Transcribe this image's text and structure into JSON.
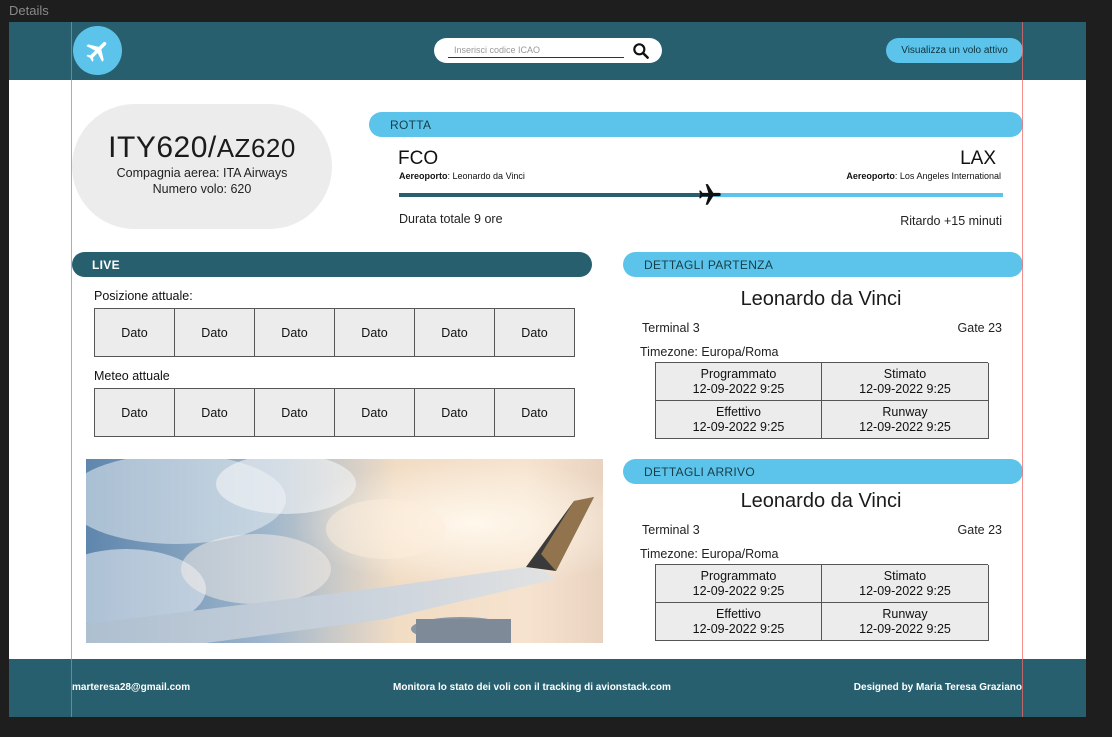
{
  "frame_label": "Details",
  "header": {
    "search_placeholder": "Inserisci codice ICAO",
    "active_flight_button": "Visualizza un volo attivo"
  },
  "flight": {
    "code_main": "ITY620/",
    "code_alt": "AZ620",
    "airline": "Compagnia aerea: ITA Airways",
    "number": "Numero volo: 620"
  },
  "route": {
    "title": "ROTTA",
    "origin_code": "FCO",
    "origin_airport_label": "Aereoporto",
    "origin_airport": ": Leonardo da Vinci",
    "destination_code": "LAX",
    "destination_airport_label": "Aereoporto",
    "destination_airport": ": Los Angeles International",
    "progress": 0.5,
    "duration": "Durata totale 9 ore",
    "delay": "Ritardo +15 minuti"
  },
  "live": {
    "title": "LIVE",
    "position_label": "Posizione attuale:",
    "position_cells": [
      "Dato",
      "Dato",
      "Dato",
      "Dato",
      "Dato",
      "Dato"
    ],
    "weather_label": "Meteo attuale",
    "weather_cells": [
      "Dato",
      "Dato",
      "Dato",
      "Dato",
      "Dato",
      "Dato"
    ]
  },
  "departure": {
    "title": "DETTAGLI PARTENZA",
    "airport": "Leonardo da Vinci",
    "terminal": "Terminal 3",
    "gate": "Gate 23",
    "timezone": "Timezone: Europa/Roma",
    "scheduled_label": "Programmato",
    "scheduled": "12-09-2022 9:25",
    "estimated_label": "Stimato",
    "estimated": "12-09-2022 9:25",
    "actual_label": "Effettivo",
    "actual": "12-09-2022 9:25",
    "runway_label": "Runway",
    "runway": "12-09-2022 9:25"
  },
  "arrival": {
    "title": "DETTAGLI ARRIVO",
    "airport": "Leonardo da Vinci",
    "terminal": "Terminal 3",
    "gate": "Gate 23",
    "timezone": "Timezone: Europa/Roma",
    "scheduled_label": "Programmato",
    "scheduled": "12-09-2022 9:25",
    "estimated_label": "Stimato",
    "estimated": "12-09-2022 9:25",
    "actual_label": "Effettivo",
    "actual": "12-09-2022 9:25",
    "runway_label": "Runway",
    "runway": "12-09-2022 9:25"
  },
  "footer": {
    "email": "marteresa28@gmail.com",
    "tagline": "Monitora lo stato dei voli con il tracking di avionstack.com",
    "credits": "Designed by Maria Teresa Graziano"
  },
  "icons": {
    "logo": "airplane-icon",
    "search": "search-icon",
    "route_plane": "airplane-icon"
  },
  "colors": {
    "primary_dark": "#275f6f",
    "accent_light": "#5cc4ea",
    "panel_gray": "#ececec"
  }
}
